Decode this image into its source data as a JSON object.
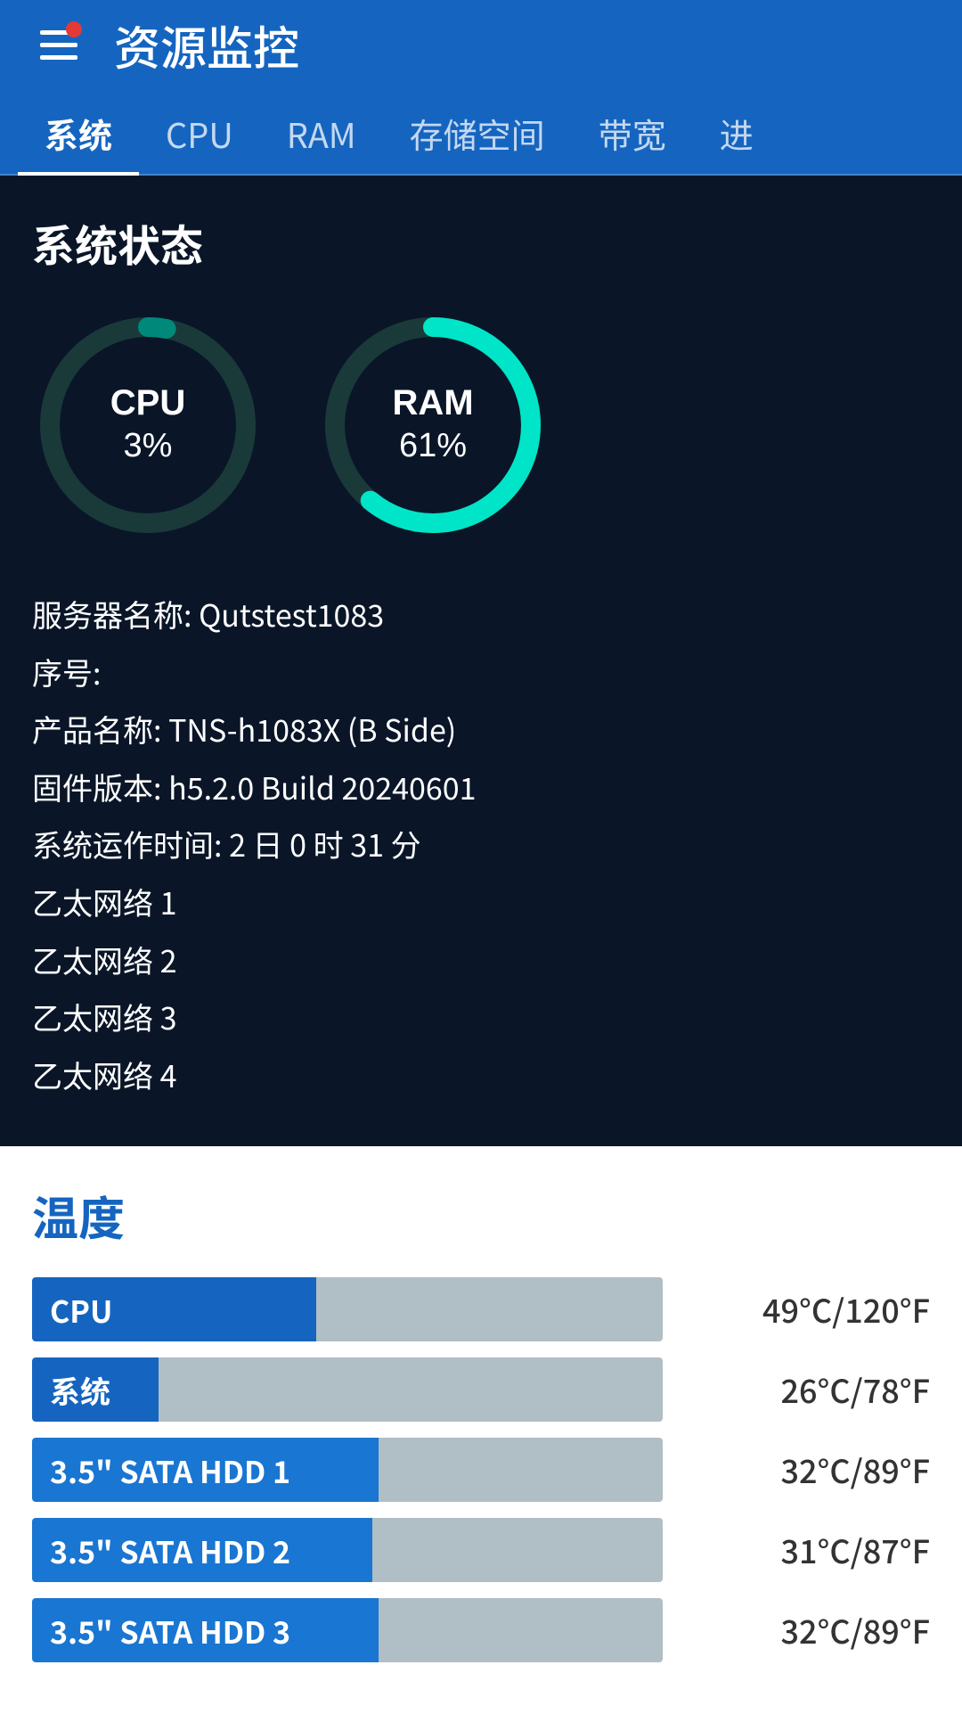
{
  "header": {
    "title": "资源监控",
    "notification": true
  },
  "tabs": [
    {
      "id": "system",
      "label": "系统",
      "active": true
    },
    {
      "id": "cpu",
      "label": "CPU",
      "active": false
    },
    {
      "id": "ram",
      "label": "RAM",
      "active": false
    },
    {
      "id": "storage",
      "label": "存储空间",
      "active": false
    },
    {
      "id": "bandwidth",
      "label": "带宽",
      "active": false
    },
    {
      "id": "more",
      "label": "进",
      "active": false
    }
  ],
  "system_status": {
    "title": "系统状态",
    "cpu": {
      "label": "CPU",
      "value": "3%",
      "percent": 3
    },
    "ram": {
      "label": "RAM",
      "value": "61%",
      "percent": 61
    },
    "info": [
      {
        "key": "服务器名称",
        "value": "Qutstest1083"
      },
      {
        "key": "序号",
        "value": ""
      },
      {
        "key": "产品名称",
        "value": " TNS-h1083X (B Side)"
      },
      {
        "key": "固件版本",
        "value": "h5.2.0 Build 20240601"
      },
      {
        "key": "系统运作时间",
        "value": "2 日 0 时 31 分"
      },
      {
        "key": "乙太网络 1",
        "value": ""
      },
      {
        "key": "乙太网络 2",
        "value": ""
      },
      {
        "key": "乙太网络 3",
        "value": ""
      },
      {
        "key": "乙太网络 4",
        "value": ""
      }
    ]
  },
  "temperature": {
    "title": "温度",
    "items": [
      {
        "label": "CPU",
        "fill_percent": 45,
        "value": "49°C/120°F",
        "fill_color": "#1565c0"
      },
      {
        "label": "系统",
        "fill_percent": 20,
        "value": "26°C/78°F",
        "fill_color": "#1565c0"
      },
      {
        "label": "3.5\" SATA HDD 1",
        "fill_percent": 55,
        "value": "32°C/89°F",
        "fill_color": "#1976d2"
      },
      {
        "label": "3.5\" SATA HDD 2",
        "fill_percent": 54,
        "value": "31°C/87°F",
        "fill_color": "#1976d2"
      },
      {
        "label": "3.5\" SATA HDD 3",
        "fill_percent": 55,
        "value": "32°C/89°F",
        "fill_color": "#1976d2"
      }
    ]
  }
}
